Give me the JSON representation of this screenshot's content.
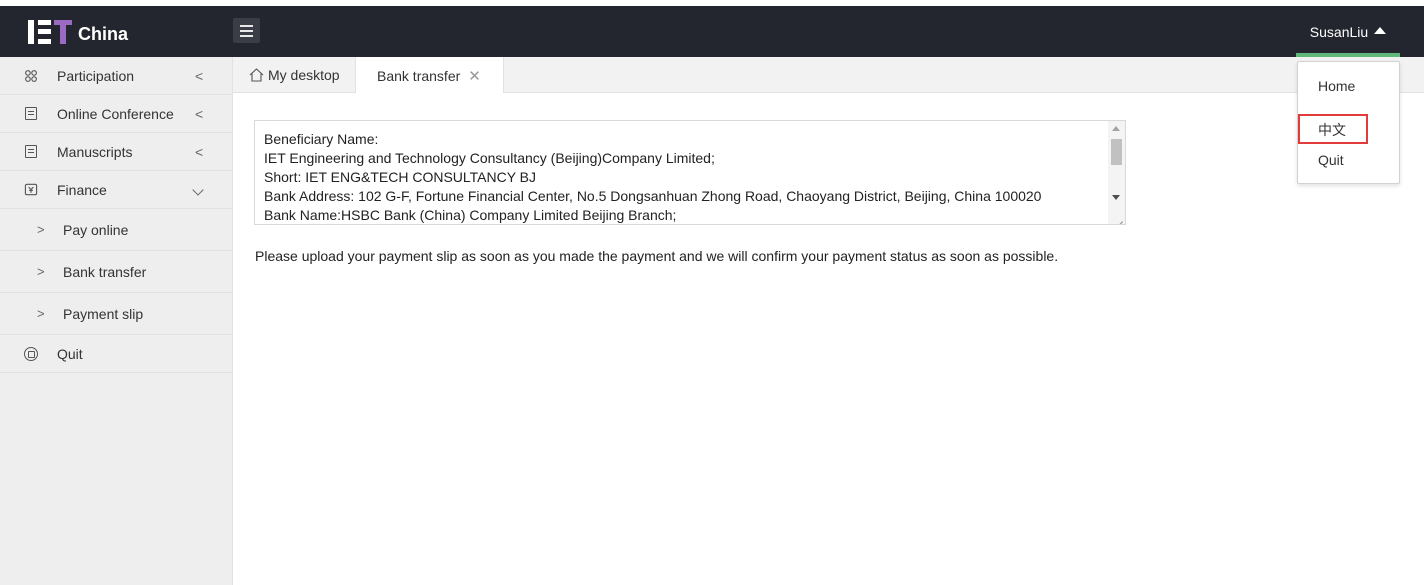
{
  "app": {
    "logo_text": "China",
    "brand_color": "#9b6bc4",
    "topbar_color": "#23262e",
    "accent_color": "#5fb878"
  },
  "header": {
    "user_name": "SusanLiu",
    "dropdown": {
      "items": [
        {
          "label": "Home"
        },
        {
          "label": "中文",
          "highlighted": true,
          "highlight_color": "#e23b3b"
        },
        {
          "label": "Quit"
        }
      ]
    }
  },
  "sidebar": {
    "items": [
      {
        "label": "Participation",
        "icon": "grid-icon",
        "expanded": false
      },
      {
        "label": "Online Conference",
        "icon": "document-icon",
        "expanded": false
      },
      {
        "label": "Manuscripts",
        "icon": "document-icon",
        "expanded": false
      },
      {
        "label": "Finance",
        "icon": "finance-icon",
        "expanded": true,
        "children": [
          {
            "label": "Pay online"
          },
          {
            "label": "Bank transfer"
          },
          {
            "label": "Payment slip"
          }
        ]
      },
      {
        "label": "Quit",
        "icon": "quit-icon"
      }
    ]
  },
  "tabs": [
    {
      "label": "My desktop",
      "icon": "home-icon",
      "active": false
    },
    {
      "label": "Bank transfer",
      "active": true,
      "closable": true
    }
  ],
  "main": {
    "bank_info_lines": [
      "Beneficiary Name:",
      "IET Engineering and Technology Consultancy (Beijing)Company Limited;",
      "Short: IET ENG&TECH CONSULTANCY BJ",
      "Bank Address: 102 G-F, Fortune Financial Center, No.5 Dongsanhuan Zhong Road, Chaoyang District, Beijing, China 100020",
      "Bank Name:HSBC Bank (China) Company Limited Beijing Branch;"
    ],
    "notice": "Please upload your payment slip as soon as you made the payment and we will confirm your payment status as soon as possible."
  }
}
